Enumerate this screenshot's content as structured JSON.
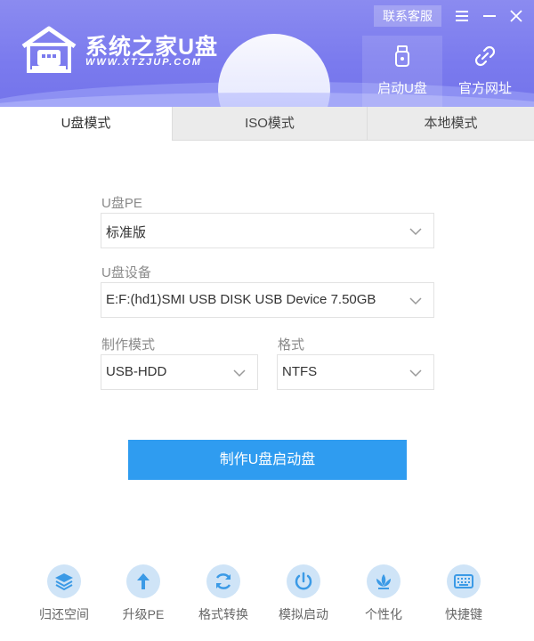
{
  "header": {
    "brand_title": "系统之家U盘",
    "brand_url": "WWW.XTZJUP.COM",
    "contact_label": "联系客服",
    "menu_icon": "menu-icon",
    "minimize_icon": "minimize-icon",
    "close_icon": "close-icon",
    "tools": [
      {
        "label": "启动U盘",
        "icon": "usb-drive-icon",
        "active": true
      },
      {
        "label": "官方网址",
        "icon": "link-icon",
        "active": false
      }
    ]
  },
  "tabs": [
    {
      "label": "U盘模式",
      "active": true
    },
    {
      "label": "ISO模式",
      "active": false
    },
    {
      "label": "本地模式",
      "active": false
    }
  ],
  "form": {
    "pe_label": "U盘PE",
    "pe_value": "标准版",
    "device_label": "U盘设备",
    "device_value": "E:F:(hd1)SMI USB DISK USB Device 7.50GB",
    "mode_label": "制作模式",
    "mode_value": "USB-HDD",
    "format_label": "格式",
    "format_value": "NTFS"
  },
  "primary_button": "制作U盘启动盘",
  "bottom_tools": [
    {
      "label": "归还空间",
      "icon": "layers-icon"
    },
    {
      "label": "升级PE",
      "icon": "upgrade-arrow-icon"
    },
    {
      "label": "格式转换",
      "icon": "refresh-icon"
    },
    {
      "label": "模拟启动",
      "icon": "power-icon"
    },
    {
      "label": "个性化",
      "icon": "lotus-icon"
    },
    {
      "label": "快捷键",
      "icon": "keyboard-icon"
    }
  ],
  "colors": {
    "header_bg": "#7a7aee",
    "primary": "#2f9cf0",
    "tool_circle": "#cfe4f7",
    "tool_icon": "#3b9ae6"
  }
}
